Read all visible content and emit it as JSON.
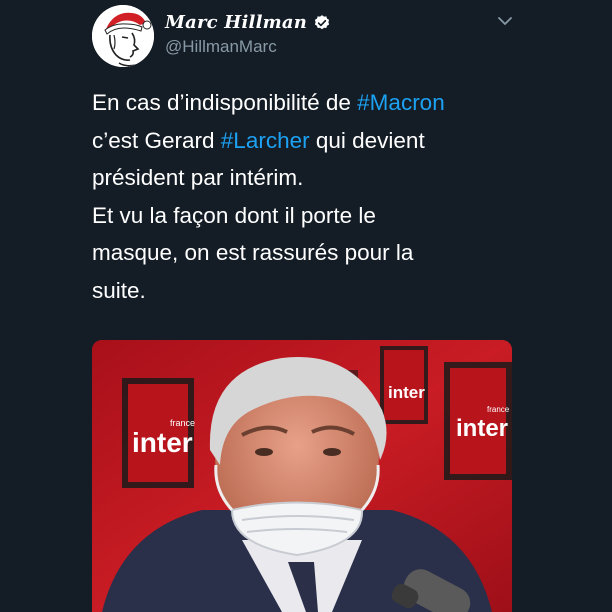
{
  "tweet": {
    "author": {
      "display_name": "Marc Hillman",
      "handle": "@HillmanMarc",
      "verified": true
    },
    "text_lines": [
      {
        "before": "En cas d’indisponibilité de ",
        "hashtag": "#Macron",
        "after": ""
      },
      {
        "before": "c’est Gerard ",
        "hashtag": "#Larcher",
        "after": " qui devient"
      },
      {
        "before": "président par intérim.",
        "hashtag": "",
        "after": ""
      },
      {
        "before": "Et vu la façon dont il porte le",
        "hashtag": "",
        "after": ""
      },
      {
        "before": "masque, on est rassurés pour la",
        "hashtag": "",
        "after": ""
      },
      {
        "before": "suite.",
        "hashtag": "",
        "after": ""
      }
    ],
    "media": {
      "logo_brand_small": "france",
      "logo_brand": "inter"
    }
  },
  "colors": {
    "background": "#141d26",
    "text": "#ffffff",
    "secondary_text": "#8899a6",
    "link": "#1da1f2",
    "verified_badge": "#ffffff",
    "media_red": "#b3141d"
  },
  "icons": {
    "verified": "verified-badge-icon",
    "menu": "chevron-down-icon"
  }
}
